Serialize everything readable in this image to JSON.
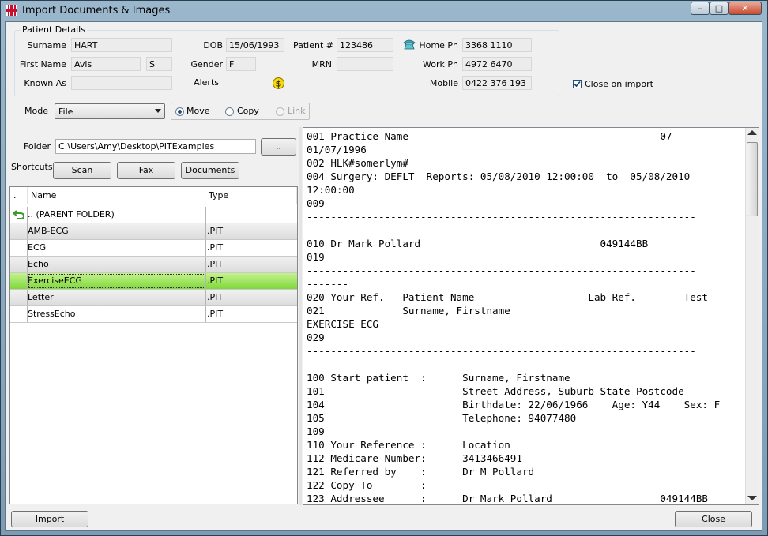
{
  "window": {
    "title": "Import Documents & Images",
    "minimize": "–",
    "maximize": "□",
    "close": "✕"
  },
  "patient": {
    "legend": "Patient Details",
    "surname_label": "Surname",
    "surname": "HART",
    "firstname_label": "First Name",
    "firstname": "Avis",
    "middle": "S",
    "knownas_label": "Known As",
    "knownas": "",
    "dob_label": "DOB",
    "dob": "15/06/1993",
    "gender_label": "Gender",
    "gender": "F",
    "alerts_label": "Alerts",
    "patientno_label": "Patient #",
    "patientno": "123486",
    "mrn_label": "MRN",
    "mrn": "",
    "homeph_label": "Home Ph",
    "homeph": "3368 1110",
    "workph_label": "Work Ph",
    "workph": "4972 6470",
    "mobile_label": "Mobile",
    "mobile": "0422 376 193"
  },
  "close_on_import": {
    "label": "Close on import",
    "checked": true
  },
  "mode": {
    "label": "Mode",
    "value": "File",
    "options": [
      "Move",
      "Copy",
      "Link"
    ],
    "selected": "Move"
  },
  "folder": {
    "label": "Folder",
    "value": "C:\\Users\\Amy\\Desktop\\PITExamples",
    "browse": ".."
  },
  "shortcuts": {
    "label": "Shortcuts",
    "buttons": [
      "Scan",
      "Fax",
      "Documents"
    ]
  },
  "list": {
    "headers": [
      ".",
      "Name",
      "Type"
    ],
    "rows": [
      {
        "name": ".. (PARENT FOLDER)",
        "type": ""
      },
      {
        "name": "AMB-ECG",
        "type": ".PIT"
      },
      {
        "name": "ECG",
        "type": ".PIT"
      },
      {
        "name": "Echo",
        "type": ".PIT"
      },
      {
        "name": "ExerciseECG",
        "type": ".PIT"
      },
      {
        "name": "Letter",
        "type": ".PIT"
      },
      {
        "name": "StressEcho",
        "type": ".PIT"
      }
    ]
  },
  "report_lines": [
    "001 Practice Name                                          07",
    "01/07/1996",
    "002 HLK#somerlym#",
    "004 Surgery: DEFLT  Reports: 05/08/2010 12:00:00  to  05/08/2010",
    "12:00:00",
    "009",
    "-----------------------------------------------------------------",
    "-------",
    "010 Dr Mark Pollard                              049144BB",
    "019",
    "-----------------------------------------------------------------",
    "-------",
    "020 Your Ref.   Patient Name                   Lab Ref.        Test",
    "021             Surname, Firstname",
    "EXERCISE ECG",
    "029",
    "-----------------------------------------------------------------",
    "-------",
    "100 Start patient  :      Surname, Firstname",
    "101                       Street Address, Suburb State Postcode",
    "104                       Birthdate: 22/06/1966    Age: Y44    Sex: F",
    "105                       Telephone: 94077480",
    "109",
    "110 Your Reference :      Location",
    "112 Medicare Number:      3413466491",
    "121 Referred by    :      Dr M Pollard",
    "122 Copy To        :",
    "123 Addressee      :      Dr Mark Pollard                  049144BB"
  ],
  "buttons": {
    "import": "Import",
    "close": "Close"
  },
  "colors": {
    "selected_row": "#7fd83a",
    "alert": "#e8c400"
  },
  "icons": [
    "app-plus-icon",
    "phone-icon",
    "dollar-alert-icon",
    "back-arrow-icon",
    "dropdown-arrow-icon"
  ]
}
